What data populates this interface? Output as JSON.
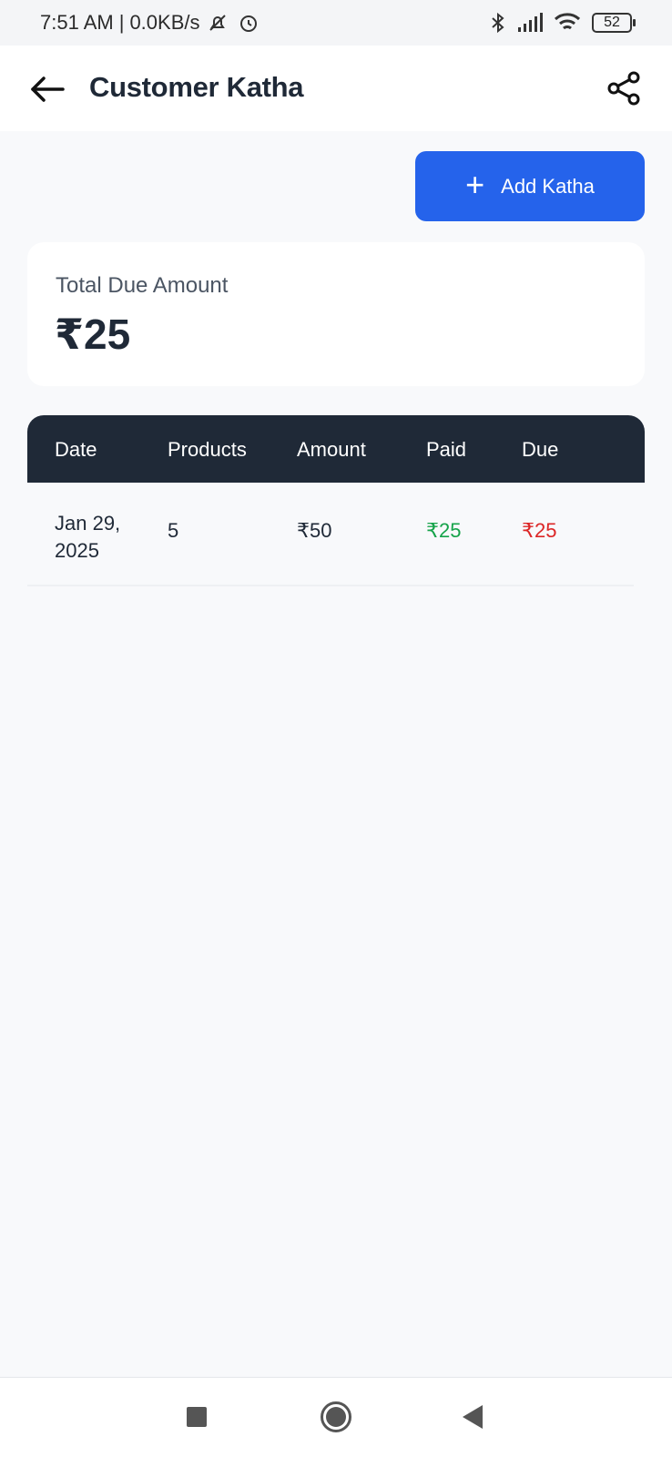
{
  "status_bar": {
    "time": "7:51 AM",
    "separator": "|",
    "network_speed": "0.0KB/s",
    "battery": "52",
    "icons": [
      "mute-bell-icon",
      "alarm-icon",
      "bluetooth-icon",
      "signal-icon",
      "wifi-icon",
      "battery-icon"
    ]
  },
  "app_bar": {
    "title": "Customer Katha",
    "back_icon": "arrow-left-icon",
    "share_icon": "share-icon"
  },
  "actions": {
    "add_label": "Add Katha",
    "add_icon": "plus-icon"
  },
  "summary": {
    "label": "Total Due Amount",
    "value": "₹25"
  },
  "table": {
    "headers": {
      "date": "Date",
      "products": "Products",
      "amount": "Amount",
      "paid": "Paid",
      "due": "Due"
    },
    "rows": [
      {
        "date": "Jan 29, 2025",
        "products": "5",
        "amount": "₹50",
        "paid": "₹25",
        "due": "₹25"
      }
    ]
  },
  "colors": {
    "accent": "#2563eb",
    "header_bg": "#1f2937",
    "paid": "#16a34a",
    "due": "#dc2626"
  },
  "nav_bar": {
    "icons": [
      "recents-square-icon",
      "home-circle-icon",
      "back-triangle-icon"
    ]
  }
}
